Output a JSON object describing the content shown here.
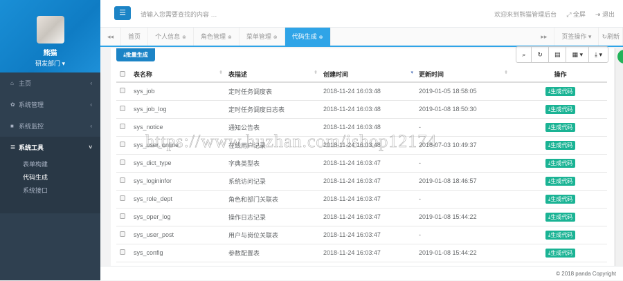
{
  "sidebar": {
    "user_name": "熊猫",
    "dept": "研发部门",
    "items": [
      {
        "label": "主页",
        "icon": "home-icon"
      },
      {
        "label": "系统管理",
        "icon": "gear-icon"
      },
      {
        "label": "系统监控",
        "icon": "video-icon"
      },
      {
        "label": "系统工具",
        "icon": "bars-icon"
      }
    ],
    "sub_items": [
      "表单构建",
      "代码生成",
      "系统接口"
    ]
  },
  "header": {
    "search_placeholder": "请输入您需要查找的内容 …",
    "welcome": "欢迎来到熊猫管理后台",
    "fullscreen": "全屏",
    "logout": "退出"
  },
  "tabs": {
    "items": [
      "首页",
      "个人信息",
      "角色管理",
      "菜单管理",
      "代码生成"
    ],
    "page_ops": "页签操作",
    "refresh": "刷新"
  },
  "toolbar": {
    "batch": "批量生成"
  },
  "table": {
    "headers": [
      "表名称",
      "表描述",
      "创建时间",
      "更新时间",
      "操作"
    ],
    "action_label": "生成代码",
    "rows": [
      [
        "sys_job",
        "定时任务调度表",
        "2018-11-24 16:03:48",
        "2019-01-05 18:58:05"
      ],
      [
        "sys_job_log",
        "定时任务调度日志表",
        "2018-11-24 16:03:48",
        "2019-01-08 18:50:30"
      ],
      [
        "sys_notice",
        "通知公告表",
        "2018-11-24 16:03:48",
        "-"
      ],
      [
        "sys_user_online",
        "在线用户记录",
        "2018-11-24 16:03:48",
        "2018-07-03 10:49:37"
      ],
      [
        "sys_dict_type",
        "字典类型表",
        "2018-11-24 16:03:47",
        "-"
      ],
      [
        "sys_logininfor",
        "系统访问记录",
        "2018-11-24 16:03:47",
        "2019-01-08 18:46:57"
      ],
      [
        "sys_role_dept",
        "角色和部门关联表",
        "2018-11-24 16:03:47",
        "-"
      ],
      [
        "sys_oper_log",
        "操作日志记录",
        "2018-11-24 16:03:47",
        "2019-01-08 15:44:22"
      ],
      [
        "sys_user_post",
        "用户与岗位关联表",
        "2018-11-24 16:03:47",
        "-"
      ],
      [
        "sys_config",
        "参数配置表",
        "2018-11-24 16:03:47",
        "2019-01-08 15:44:22"
      ]
    ]
  },
  "footer": {
    "copyright": "© 2018 panda Copyright"
  },
  "watermark": "https://www.huzhan.com/ishop12174"
}
